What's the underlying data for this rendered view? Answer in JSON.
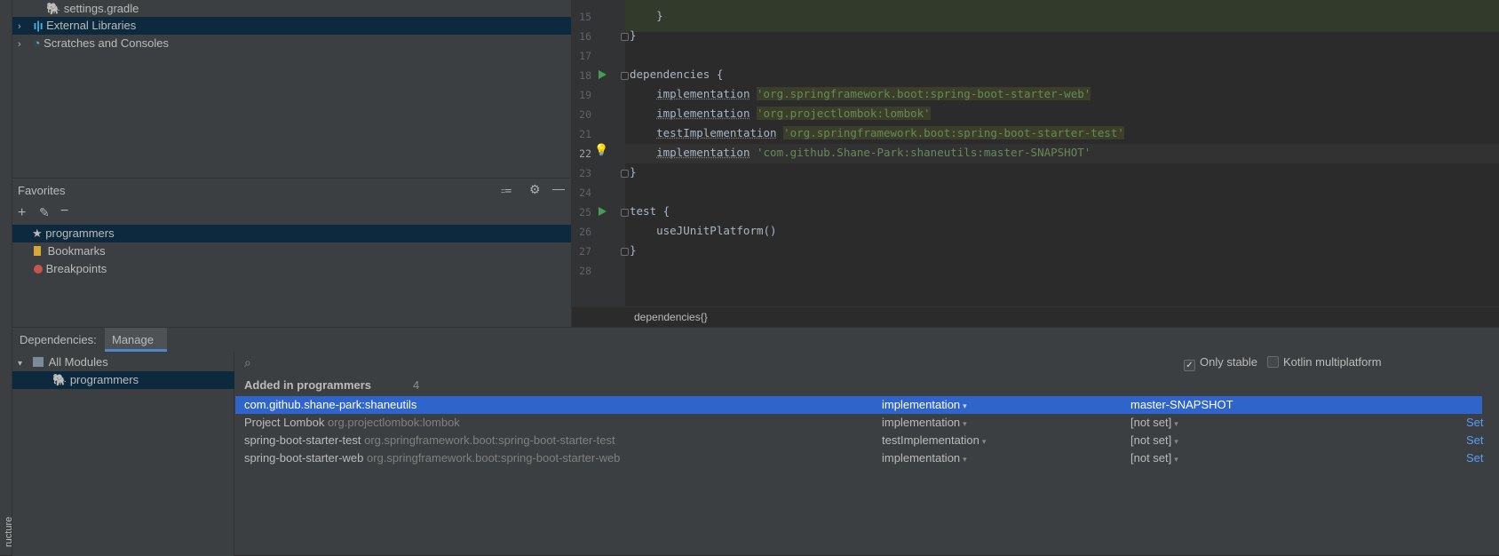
{
  "project_tree": {
    "items": [
      {
        "label": "settings.gradle",
        "selected": false,
        "icon": "gradle-icon"
      },
      {
        "label": "External Libraries",
        "selected": true,
        "icon": "libraries-icon"
      },
      {
        "label": "Scratches and Consoles",
        "selected": false,
        "icon": "scratches-icon"
      }
    ]
  },
  "favorites": {
    "title": "Favorites",
    "items": [
      {
        "label": "programmers",
        "icon": "star-icon",
        "selected": true
      },
      {
        "label": "Bookmarks",
        "icon": "bookmark-icon",
        "selected": false
      },
      {
        "label": "Breakpoints",
        "icon": "breakpoint-icon",
        "selected": false
      }
    ]
  },
  "editor": {
    "line_numbers": [
      "15",
      "16",
      "17",
      "18",
      "19",
      "20",
      "21",
      "22",
      "23",
      "24",
      "25",
      "26",
      "27",
      "28"
    ],
    "current_line": "22",
    "lines": {
      "l15": "    }",
      "l16": "}",
      "l18": "dependencies {",
      "l19_kw": "implementation",
      "l19_str": "'org.springframework.boot:spring-boot-starter-web'",
      "l20_kw": "implementation",
      "l20_str": "'org.projectlombok:lombok'",
      "l21_kw": "testImplementation",
      "l21_str": "'org.springframework.boot:spring-boot-starter-test'",
      "l22_kw": "implementation",
      "l22_str": "'com.github.Shane-Park:shaneutils:master-SNAPSHOT'",
      "l23": "}",
      "l25": "test {",
      "l26": "    useJUnitPlatform()",
      "l27": "}"
    },
    "breadcrumb": "dependencies{}"
  },
  "dependencies_panel": {
    "tabs": [
      "Dependencies:",
      "Manage"
    ],
    "modules": [
      {
        "label": "All Modules",
        "icon": "modules-icon"
      },
      {
        "label": "programmers",
        "icon": "gradle-icon"
      }
    ],
    "only_stable_label": "Only stable",
    "only_stable_checked": true,
    "kotlin_label": "Kotlin multiplatform",
    "kotlin_checked": false,
    "section_title": "Added in programmers",
    "section_count": "4",
    "rows": [
      {
        "name": "com.github.shane-park:shaneutils",
        "coord": "",
        "scope": "implementation",
        "version": "master-SNAPSHOT",
        "action": ""
      },
      {
        "name": "Project Lombok",
        "coord": "org.projectlombok:lombok",
        "scope": "implementation",
        "version": "[not set]",
        "action": "Set"
      },
      {
        "name": "spring-boot-starter-test",
        "coord": "org.springframework.boot:spring-boot-starter-test",
        "scope": "testImplementation",
        "version": "[not set]",
        "action": "Set"
      },
      {
        "name": "spring-boot-starter-web",
        "coord": "org.springframework.boot:spring-boot-starter-web",
        "scope": "implementation",
        "version": "[not set]",
        "action": "Set"
      }
    ],
    "structure_label": "ructure"
  },
  "colors": {
    "selection": "#2f65ca",
    "tree_selection": "#0d293e",
    "string": "#6a8759",
    "link": "#589df6"
  }
}
